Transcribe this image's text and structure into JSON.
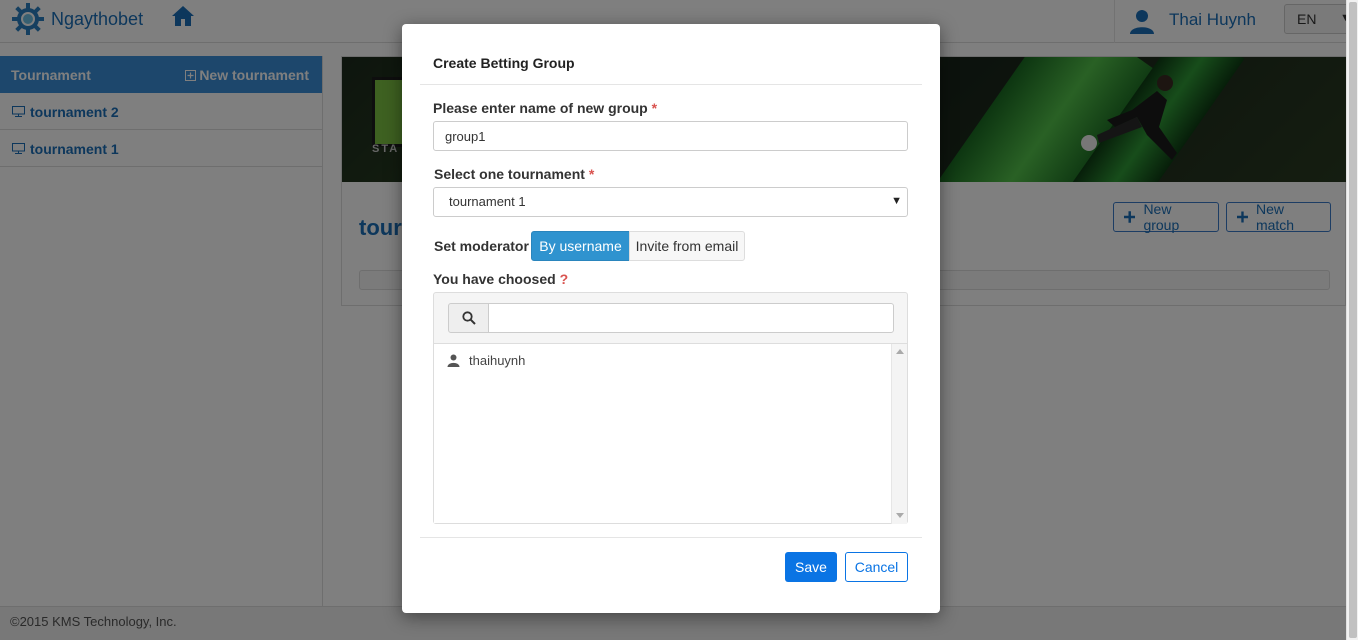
{
  "app": {
    "brand": "Ngaythobet"
  },
  "header": {
    "user_name": "Thai Huynh",
    "language": "EN"
  },
  "sidebar": {
    "title": "Tournament",
    "new_label": "New tournament",
    "items": [
      {
        "label": "tournament 2"
      },
      {
        "label": "tournament 1"
      }
    ]
  },
  "main": {
    "title_partial": "tour",
    "new_group_label": "New group",
    "new_match_label": "New match"
  },
  "footer": {
    "text": "©2015 KMS Technology, Inc."
  },
  "modal": {
    "title": "Create Betting Group",
    "group_name_label": "Please enter name of new group",
    "group_name_value": "group1",
    "tournament_label": "Select one tournament",
    "tournament_value": "tournament 1",
    "moderator_label": "Set moderator",
    "by_username_label": "By username",
    "invite_email_label": "Invite from email",
    "chosen_label": "You have choosed",
    "help_mark": "?",
    "required_mark": "*",
    "search_value": "",
    "chosen_users": [
      {
        "username": "thaihuynh"
      }
    ],
    "save_label": "Save",
    "cancel_label": "Cancel"
  },
  "colors": {
    "primary": "#1a6fb8",
    "sidebar_header": "#3a8fd8",
    "toggle_active": "#2f93cf",
    "save_button": "#0a74e4",
    "required": "#d9534f"
  },
  "icons": {
    "brand": "gear-logo-icon",
    "home": "home-icon",
    "user": "user-icon",
    "tournament_item": "monitor-icon",
    "add": "plus-icon",
    "search": "search-icon",
    "chosen_user": "person-icon"
  }
}
